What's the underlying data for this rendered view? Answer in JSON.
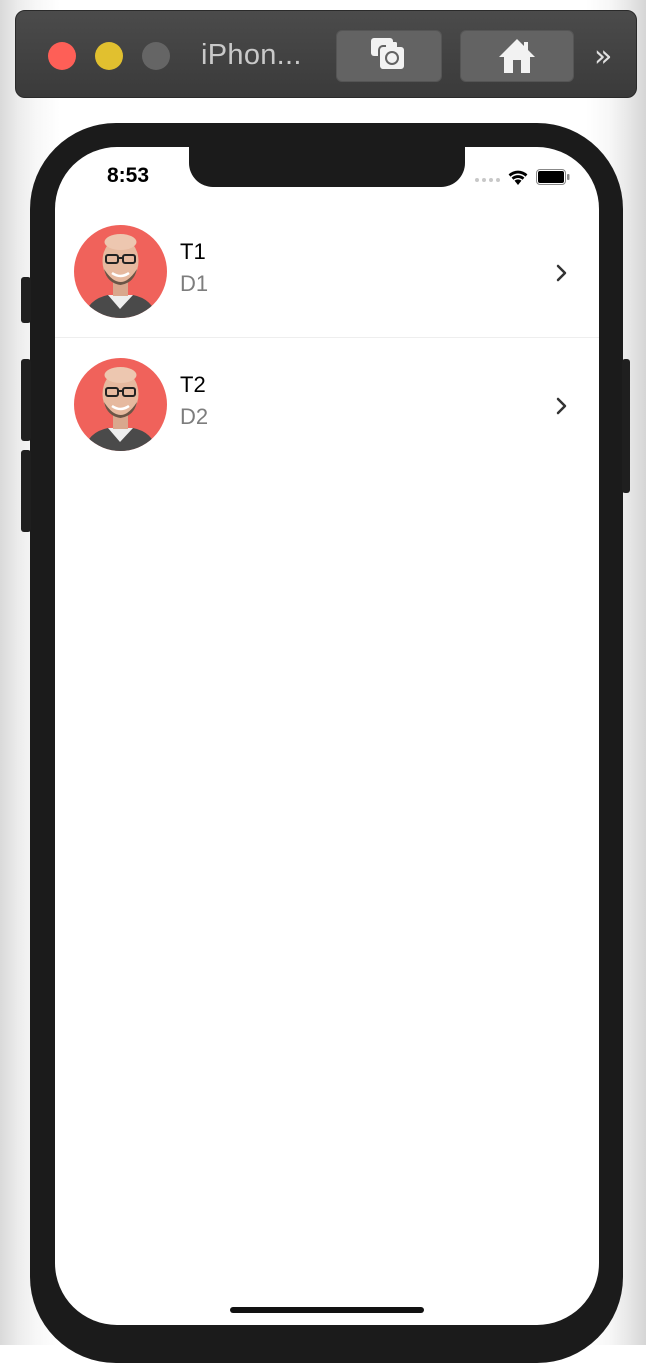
{
  "window": {
    "title": "iPhon...",
    "overflow_glyph": "»",
    "buttons": [
      {
        "name": "screenshot-button",
        "icon": "camera-icon"
      },
      {
        "name": "home-button",
        "icon": "home-icon"
      }
    ]
  },
  "status_bar": {
    "time": "8:53"
  },
  "list": {
    "items": [
      {
        "title": "T1",
        "description": "D1"
      },
      {
        "title": "T2",
        "description": "D2"
      }
    ]
  },
  "colors": {
    "avatar_background": "#f0625b",
    "close": "#fe5f57",
    "minimize": "#e1c02f",
    "zoom": "#656565"
  }
}
